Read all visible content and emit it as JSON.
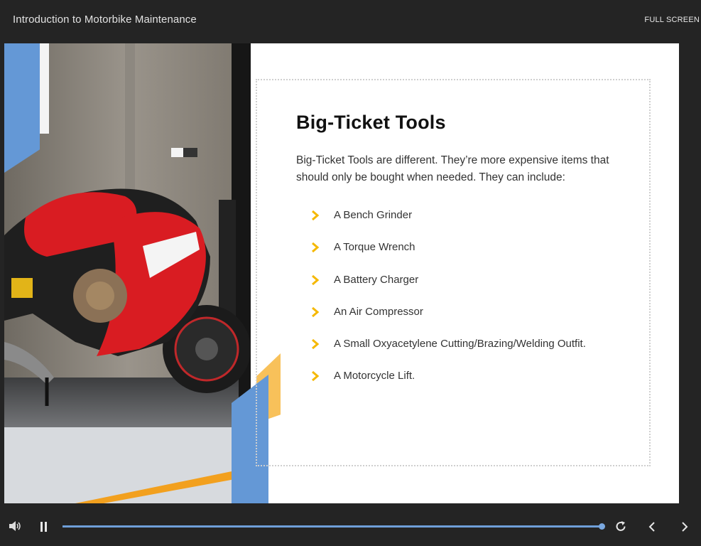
{
  "header": {
    "course_title": "Introduction to Motorbike Maintenance",
    "fullscreen_label": "FULL SCREEN"
  },
  "slide": {
    "title": "Big-Ticket Tools",
    "intro": "Big-Ticket Tools are different. They’re more expensive items that should only be bought when needed. They can include:",
    "bullets": [
      "A Bench Grinder",
      "A Torque Wrench",
      "A Battery Charger",
      "An Air Compressor",
      "A Small Oxyacetylene Cutting/Brazing/Welding Outfit.",
      "A Motorcycle Lift."
    ]
  },
  "player": {
    "progress": 1.0,
    "icons": [
      "volume-icon",
      "pause-icon",
      "replay-icon",
      "previous-icon",
      "next-icon"
    ]
  },
  "colors": {
    "accent_blue": "#6498d6",
    "accent_yellow": "#f8c15a",
    "bullet_chevron": "#f5b800",
    "bar_background": "#242424"
  }
}
